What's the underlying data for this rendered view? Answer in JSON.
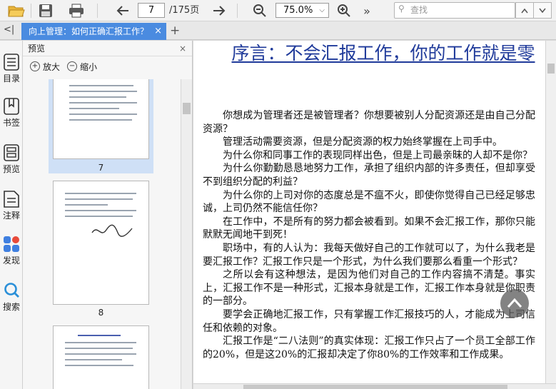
{
  "toolbar": {
    "current_page": "7",
    "total_pages": "/175页",
    "zoom": "75.0%",
    "search_placeholder": "查找",
    "more": "»"
  },
  "tabs": [
    {
      "label": "向上管理：如何正确汇报工作？",
      "close": "×"
    }
  ],
  "tab_add": "+",
  "sidebar_collapse": "<|",
  "rail": [
    {
      "label": "目录"
    },
    {
      "label": "书签"
    },
    {
      "label": "预览"
    },
    {
      "label": "注释"
    },
    {
      "label": "发现"
    },
    {
      "label": "搜索"
    }
  ],
  "preview": {
    "title": "预览",
    "close": "×",
    "zoom_in": "放大",
    "zoom_out": "缩小",
    "pages": [
      "7",
      "8"
    ]
  },
  "document": {
    "title": "序言：不会汇报工作，你的工作就是零",
    "paragraphs": [
      "你想成为管理者还是被管理者？你想要被别人分配资源还是由自己分配资源？",
      "管理活动需要资源，但是分配资源的权力始终掌握在上司手中。",
      "为什么你和同事工作的表现同样出色，但是上司最亲昧的人却不是你？",
      "为什么你勤勤恳恳地努力工作，承担了组织内部的许多责任，但却享受不到组织分配的利益？",
      "为什么你的上司对你的态度总是不瘟不火，即使你觉得自己已经足够忠诚，上司仍然不能信任你？",
      "在工作中，不是所有的努力都会被看到。如果不会汇报工作，那你只能默默无闻地干到死！",
      "职场中，有的人认为：我每天做好自己的工作就可以了，为什么我老是要汇报工作？汇报工作只是一个形式，为什么我们要那么看重一个形式？",
      "之所以会有这种想法，是因为他们对自己的工作内容搞不清楚。事实上，汇报工作不是一种形式，汇报本身就是工作，汇报工作本身就是你职责的一部分。",
      "要学会正确地汇报工作，只有掌握工作汇报技巧的人，才能成为上司信任和依赖的对象。",
      "汇报工作是“二八法则”的真实体现：汇报工作只占了一个员工全部工作的20%，但是这20%的汇报却决定了你80%的工作效率和工作成果。"
    ]
  },
  "colors": {
    "tab_active": "#4a8be0",
    "title_blue": "#1f3a9a",
    "selection": "#cfe0f6"
  }
}
